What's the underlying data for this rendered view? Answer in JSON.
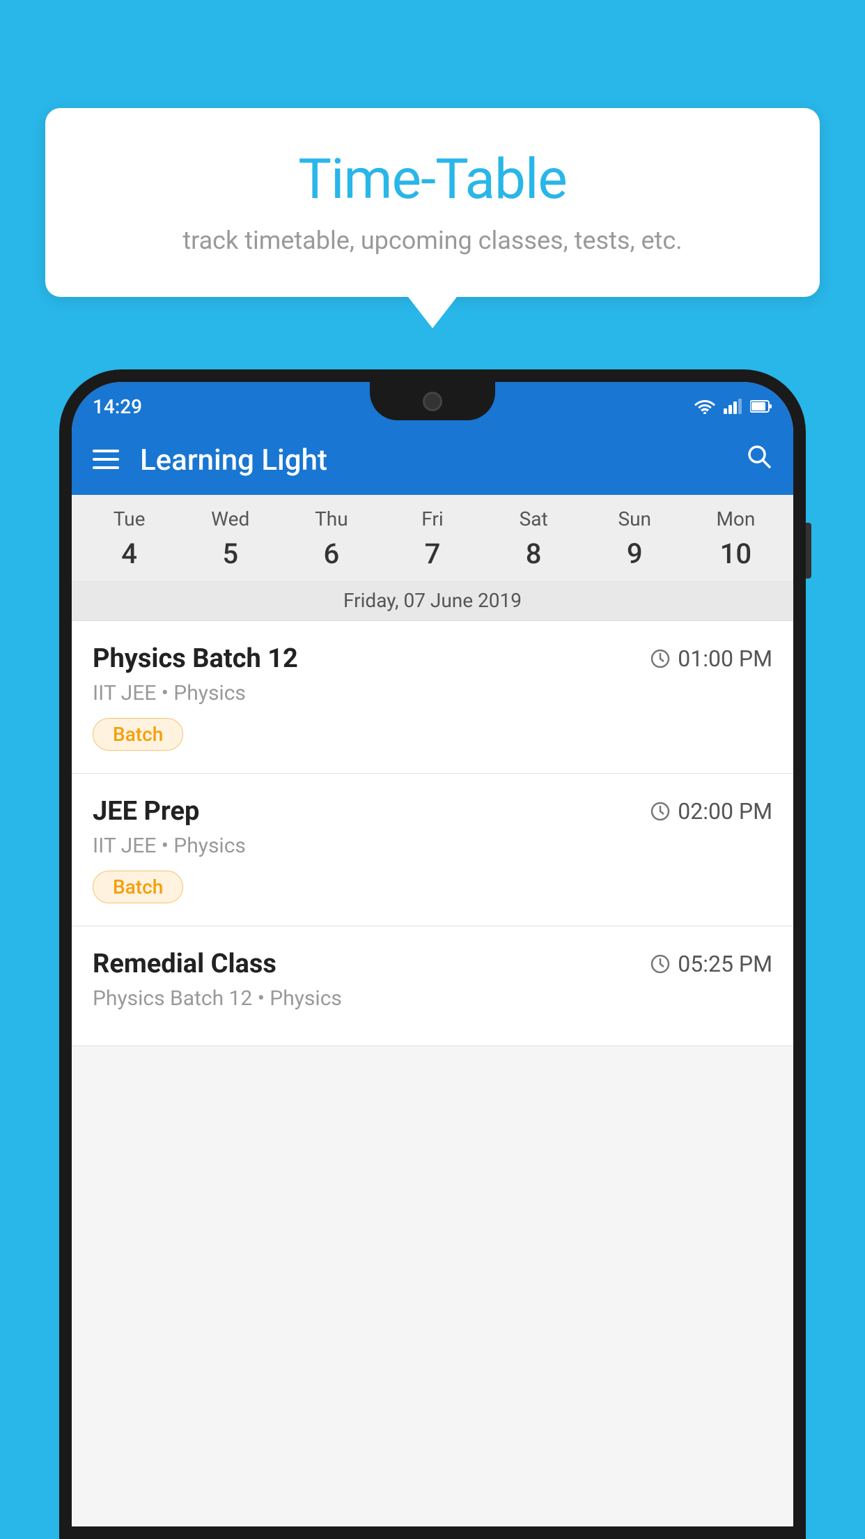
{
  "background_color": "#29b6e8",
  "speech_bubble": {
    "title": "Time-Table",
    "subtitle": "track timetable, upcoming classes, tests, etc."
  },
  "phone": {
    "status_bar": {
      "time": "14:29",
      "icons": [
        "wifi",
        "signal",
        "battery"
      ]
    },
    "app_bar": {
      "title": "Learning Light",
      "menu_icon": "☰",
      "search_icon": "🔍"
    },
    "calendar": {
      "days": [
        {
          "label": "Tue",
          "number": "4"
        },
        {
          "label": "Wed",
          "number": "5"
        },
        {
          "label": "Thu",
          "number": "6",
          "state": "today"
        },
        {
          "label": "Fri",
          "number": "7",
          "state": "selected"
        },
        {
          "label": "Sat",
          "number": "8"
        },
        {
          "label": "Sun",
          "number": "9"
        },
        {
          "label": "Mon",
          "number": "10"
        }
      ],
      "selected_date_label": "Friday, 07 June 2019"
    },
    "schedule": [
      {
        "title": "Physics Batch 12",
        "time": "01:00 PM",
        "subtitle": "IIT JEE • Physics",
        "badge": "Batch"
      },
      {
        "title": "JEE Prep",
        "time": "02:00 PM",
        "subtitle": "IIT JEE • Physics",
        "badge": "Batch"
      },
      {
        "title": "Remedial Class",
        "time": "05:25 PM",
        "subtitle": "Physics Batch 12 • Physics",
        "badge": null
      }
    ]
  }
}
